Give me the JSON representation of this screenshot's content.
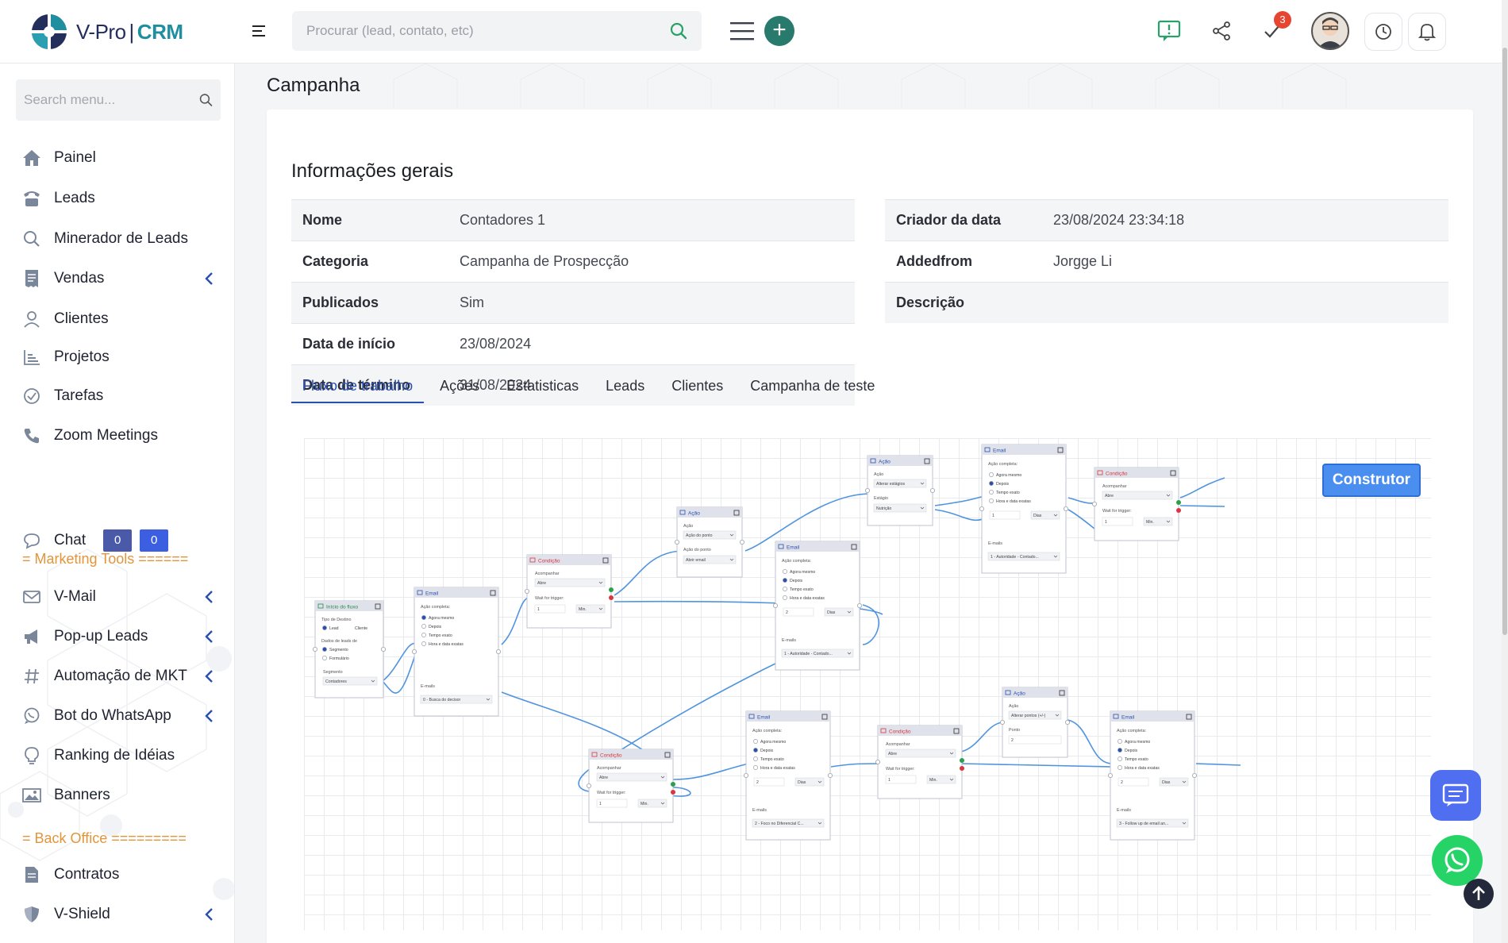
{
  "app": {
    "logo_primary": "V-Pro",
    "logo_secondary": "CRM"
  },
  "header": {
    "search_placeholder": "Procurar (lead, contato, etc)",
    "notification_count": "3"
  },
  "sidebar": {
    "search_placeholder": "Search menu...",
    "items": [
      {
        "label": "Painel"
      },
      {
        "label": "Leads"
      },
      {
        "label": "Minerador de Leads"
      },
      {
        "label": "Vendas"
      },
      {
        "label": "Clientes"
      },
      {
        "label": "Projetos"
      },
      {
        "label": "Tarefas"
      },
      {
        "label": "Zoom Meetings"
      },
      {
        "label": "Chat"
      }
    ],
    "chat_counts": [
      "0",
      "0"
    ],
    "section_marketing": "= Marketing Tools ======",
    "marketing_items": [
      {
        "label": "V-Mail"
      },
      {
        "label": "Pop-up Leads"
      },
      {
        "label": "Automação de MKT"
      },
      {
        "label": "Bot do WhatsApp"
      },
      {
        "label": "Ranking de Idéias"
      },
      {
        "label": "Banners"
      }
    ],
    "section_backoffice": "= Back Office =========",
    "backoffice_items": [
      {
        "label": "Contratos"
      },
      {
        "label": "V-Shield"
      }
    ]
  },
  "page": {
    "title": "Campanha",
    "section_title": "Informações gerais",
    "left_info": [
      {
        "key": "Nome",
        "value": "Contadores 1"
      },
      {
        "key": "Categoria",
        "value": "Campanha de Prospecção"
      },
      {
        "key": "Publicados",
        "value": "Sim"
      },
      {
        "key": "Data de início",
        "value": "23/08/2024"
      },
      {
        "key": "Data de término",
        "value": "31/08/2024"
      }
    ],
    "right_info": [
      {
        "key": "Criador da data",
        "value": "23/08/2024 23:34:18"
      },
      {
        "key": "Addedfrom",
        "value": "Jorgge Li"
      },
      {
        "key": "Descrição",
        "value": ""
      }
    ],
    "tabs": [
      "Fluxo de trabalho",
      "Ações",
      "Estatisticas",
      "Leads",
      "Clientes",
      "Campanha de teste"
    ],
    "builder_button": "Construtor"
  },
  "workflow": {
    "nodes": {
      "start": {
        "title": "Início do fluxo",
        "l1": "Tipo de Destino",
        "r1": "Lead",
        "r2": "Cliente",
        "l2": "Dados de leads de",
        "r3": "Segmento",
        "r4": "Formulário",
        "l3": "Segmento",
        "sel": "Contadores"
      },
      "email1": {
        "title": "Email",
        "l1": "Ação completa:",
        "o1": "Agora mesmo",
        "o2": "Depois",
        "o3": "Tempo exato",
        "o4": "Hora e data exatas",
        "l2": "E-mails",
        "sel": "0 - Busca do decisor"
      },
      "cond1": {
        "title": "Condição",
        "l1": "Acompanhar",
        "sel": "Abre",
        "l2": "Wait for trigger:",
        "n": "1",
        "u": "Min."
      },
      "acao1": {
        "title": "Ação",
        "l1": "Ação",
        "sel1": "Ação do ponto",
        "l2": "Ação do ponto",
        "sel2": "Abrir email"
      },
      "email2": {
        "title": "Email",
        "l1": "Ação completa:",
        "o1": "Agora mesmo",
        "o2": "Depois",
        "o3": "Tempo exato",
        "o4": "Hora e data exatas",
        "n": "2",
        "u": "Dias",
        "l2": "E-mails",
        "sel": "1 - Autoridade - Contado..."
      },
      "acao2": {
        "title": "Ação",
        "l1": "Ação",
        "sel1": "Alterar estágios",
        "l2": "Estágio",
        "sel2": "Nutrição"
      },
      "email3": {
        "title": "Email",
        "l1": "Ação completa:",
        "o1": "Agora mesmo",
        "o2": "Depois",
        "o3": "Tempo exato",
        "o4": "Hora e data exatas",
        "n": "1",
        "u": "Dias",
        "l2": "E-mails",
        "sel": "1 - Autoridade - Contado..."
      },
      "cond2": {
        "title": "Condição",
        "l1": "Acompanhar",
        "sel": "Abre",
        "l2": "Wait for trigger:",
        "n": "1",
        "u": "Min."
      },
      "cond3": {
        "title": "Condição",
        "l1": "Acompanhar",
        "sel": "Abre",
        "l2": "Wait for trigger:",
        "n": "1",
        "u": "Min."
      },
      "email4": {
        "title": "Email",
        "l1": "Ação completa:",
        "o1": "Agora mesmo",
        "o2": "Depois",
        "o3": "Tempo exato",
        "o4": "Hora e data exatas",
        "n": "2",
        "u": "Dias",
        "l2": "E-mails",
        "sel": "2 - Foco no Diferencial C..."
      },
      "cond4": {
        "title": "Condição",
        "l1": "Acompanhar",
        "sel": "Abre",
        "l2": "Wait for trigger:",
        "n": "1",
        "u": "Min."
      },
      "acao3": {
        "title": "Ação",
        "l1": "Ação",
        "sel1": "Alterar pontos (+/-)",
        "l2": "Ponto",
        "n": "2"
      },
      "email5": {
        "title": "Email",
        "l1": "Ação completa:",
        "o1": "Agora mesmo",
        "o2": "Depois",
        "o3": "Tempo exato",
        "o4": "Hora e data exatas",
        "n": "2",
        "u": "Dias",
        "l2": "E-mails",
        "sel": "3 - Follow up de email an..."
      }
    }
  },
  "colors": {
    "accent": "#2a4fb0",
    "brand_teal": "#1f8fa0",
    "section": "#e2953a",
    "chat_badge_1": "#4a5aa8",
    "chat_badge_2": "#3b5fe0",
    "builder": "#4a8ef0"
  }
}
